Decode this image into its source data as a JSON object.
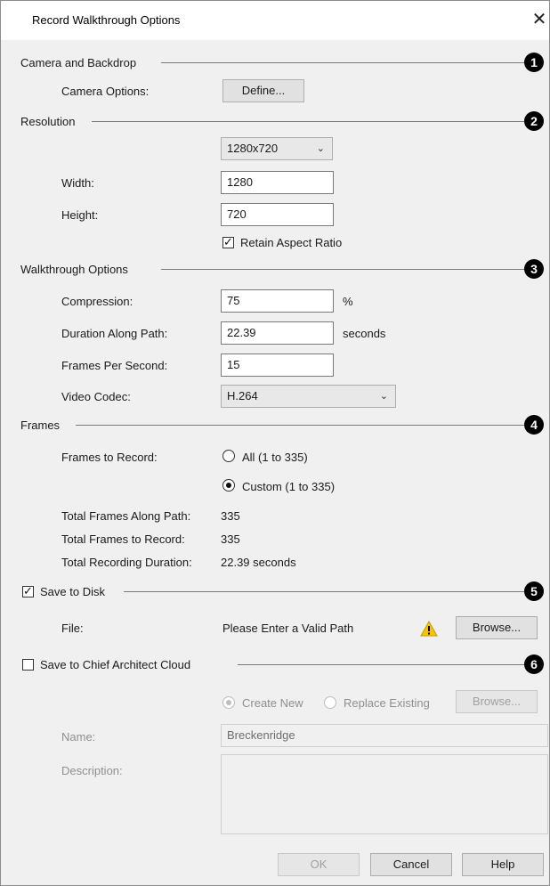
{
  "window": {
    "title": "Record Walkthrough Options",
    "close_glyph": "✕"
  },
  "sections": {
    "camera": {
      "title": "Camera and Backdrop",
      "badge": "1",
      "camera_options_label": "Camera Options:",
      "define_button": "Define..."
    },
    "resolution": {
      "title": "Resolution",
      "badge": "2",
      "preset": "1280x720",
      "width_label": "Width:",
      "width_value": "1280",
      "height_label": "Height:",
      "height_value": "720",
      "retain_aspect_label": "Retain Aspect Ratio",
      "retain_aspect_checked": true
    },
    "walkthrough": {
      "title": "Walkthrough Options",
      "badge": "3",
      "compression_label": "Compression:",
      "compression_value": "75",
      "compression_unit": "%",
      "duration_label": "Duration Along Path:",
      "duration_value": "22.39",
      "duration_unit": "seconds",
      "fps_label": "Frames Per Second:",
      "fps_value": "15",
      "codec_label": "Video Codec:",
      "codec_value": "H.264"
    },
    "frames": {
      "title": "Frames",
      "badge": "4",
      "frames_to_record_label": "Frames to Record:",
      "option_all": "All (1 to 335)",
      "option_custom": "Custom (1 to 335)",
      "selected": "custom",
      "total_along_path_label": "Total Frames Along Path:",
      "total_along_path_value": "335",
      "total_to_record_label": "Total Frames to Record:",
      "total_to_record_value": "335",
      "total_duration_label": "Total Recording Duration:",
      "total_duration_value": "22.39 seconds"
    },
    "save_disk": {
      "title": "Save to Disk",
      "badge": "5",
      "checked": true,
      "file_label": "File:",
      "file_status": "Please Enter a Valid Path",
      "warning_icon": "warning-icon",
      "browse_button": "Browse..."
    },
    "save_cloud": {
      "title": "Save to Chief Architect Cloud",
      "badge": "6",
      "checked": false,
      "option_create": "Create New",
      "option_replace": "Replace Existing",
      "browse_button": "Browse...",
      "name_label": "Name:",
      "name_value": "Breckenridge",
      "description_label": "Description:",
      "description_value": ""
    }
  },
  "footer": {
    "ok_button": "OK",
    "cancel_button": "Cancel",
    "help_button": "Help"
  },
  "colors": {
    "dialog_bg": "#f0f0f0",
    "badge": "#000000",
    "warning": "#f5c400"
  }
}
